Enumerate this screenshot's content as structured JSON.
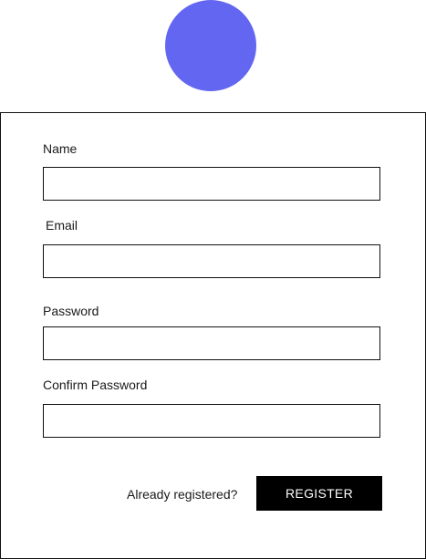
{
  "logo": {
    "color": "#6366f1"
  },
  "form": {
    "fields": [
      {
        "label": "Name",
        "value": "",
        "placeholder": ""
      },
      {
        "label": "Email",
        "value": "",
        "placeholder": ""
      },
      {
        "label": "Password",
        "value": "",
        "placeholder": ""
      },
      {
        "label": "Confirm Password",
        "value": "",
        "placeholder": ""
      }
    ],
    "login_link": "Already registered?",
    "register_button": "REGISTER",
    "button_color": "#000000",
    "button_text_color": "#ffffff"
  }
}
